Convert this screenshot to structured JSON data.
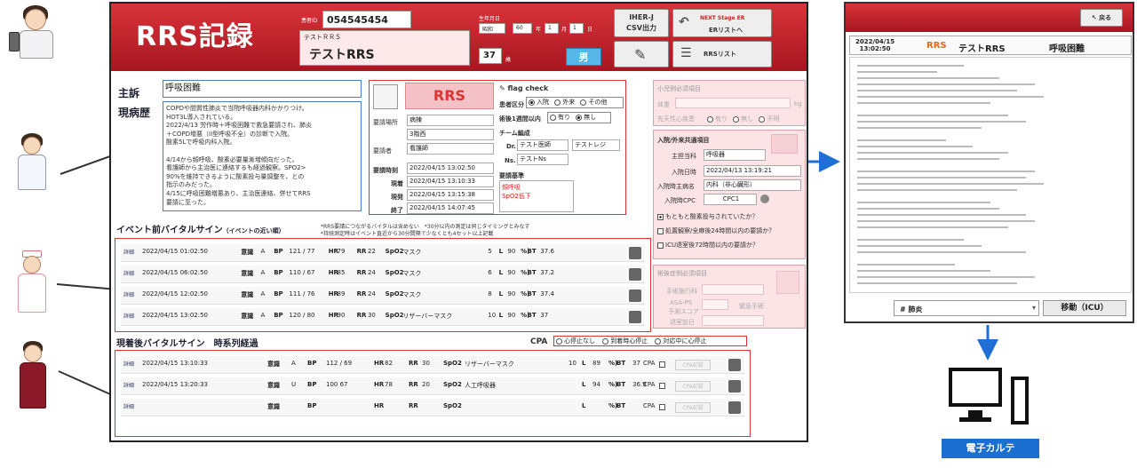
{
  "app": {
    "title": "RRS記録",
    "patient_id_label": "患者ID",
    "patient_id": "054545454",
    "kana_name": "テストＲＲＳ",
    "name": "テストRRS",
    "birth_label": "生年月日",
    "era": "昭和",
    "year": "60",
    "year_unit": "年",
    "month": "1",
    "month_unit": "月",
    "day": "1",
    "day_unit": "日",
    "age": "37",
    "age_unit": "歳",
    "sex": "男",
    "csv_button": "IHER-J\nCSV出力",
    "next_stage_logo": "NEXT Stage ER",
    "er_list_button": "ERリストへ",
    "rrs_list_button": "RRSリスト"
  },
  "complaint": {
    "label": "主訴",
    "value": "呼吸困難",
    "history_label": "現病歴",
    "history_lines": [
      "COPDや間質性肺炎で当院呼吸器内科かかりつけ。",
      "HOT3L導入されている。",
      "2022/4/13 労作時＋呼吸困難で救急要請され、肺炎",
      "＋COPD増悪（II型呼吸不全）の診断で入院。",
      "酸素5Lで呼吸内科入院。",
      "",
      "4/14から頻呼吸、酸素必要量漸増傾向だった。",
      "看護師から主治医に連絡するも経過観察。SPO2>",
      "90%を維持できるように酸素投与量調整を、との",
      "指示のみだった。",
      "4/15に呼吸困難増悪あり、主治医連絡、併せてRRS",
      "要請に至った。"
    ]
  },
  "rrs": {
    "badge": "RRS",
    "request_place_label": "要請場所",
    "request_place_1": "病棟",
    "request_place_2": "3階西",
    "requester_label": "要請者",
    "requester": "看護師",
    "request_time_label": "要請時刻",
    "request_time": "2022/04/15 13:02:50",
    "arrival_label": "現着",
    "arrival_time": "2022/04/15 13:10:33",
    "finding_label": "現発",
    "finding_time": "2022/04/15 13:15:38",
    "end_label": "終了",
    "end_time": "2022/04/15 14:07:45",
    "flag_check_label": "flag check",
    "patient_type_label": "患者区分",
    "patient_type_options": [
      "入院",
      "外来",
      "その他"
    ],
    "post_op_label": "術後1週間以内",
    "post_op_options": [
      "有り",
      "無し"
    ],
    "team_label": "チーム編成",
    "dr_label": "Dr.",
    "dr_1": "テスト医師",
    "dr_2": "テストレジ",
    "ns_label": "Ns.",
    "ns_1": "テストNs",
    "criteria_label": "要請基準",
    "criteria": [
      "頻呼吸",
      "SpO2低下"
    ]
  },
  "pediatric": {
    "title": "小児例必須項目",
    "weight_label": "体重",
    "weight_unit": "kg",
    "premature_label": "先天性心疾患",
    "premature_options": [
      "有り",
      "無し",
      "不明"
    ]
  },
  "inpatient": {
    "title": "入院/外来共通項目",
    "dept_label": "主担当科",
    "dept": "呼吸器",
    "admit_date_label": "入院日時",
    "admit_date": "2022/04/13 13:19:21",
    "admit_dx_label": "入院時主病名",
    "admit_dx": "内科（非心臓形）",
    "cpc_label": "入院時CPC",
    "cpc": "CPC1",
    "checks": [
      "もともと酸素投与されていたか？",
      "処置観察/全麻後24時間以内の要請か？",
      "ICU退室後72時間以内の要請か？"
    ]
  },
  "surgery": {
    "title": "術後症例必須項目",
    "op_dept_label": "手術施行科",
    "asa_label": "ASA-PS",
    "asa_sub": "予測スコア",
    "emergency_label": "緊急手術",
    "op_date_label": "退室前日"
  },
  "pre_vitals": {
    "title": "イベント前バイタルサイン",
    "subtitle": "（イベントの近い順）",
    "note_1": "*RRS要請につながるバイタルは含めない　*30分以内の測定は同じタイミングとみなす",
    "note_2": "*持続測定時はイベント直近から30分間隔で少なくとも4セット以上記載",
    "rows": [
      {
        "label": "詳細",
        "time": "2022/04/15 01:02:50",
        "conscious": "A",
        "bp": "121 / 77",
        "hr": "79",
        "rr": "22",
        "o2": "マスク",
        "flow": "5",
        "spo2": "90",
        "bt": "37.6"
      },
      {
        "label": "詳細",
        "time": "2022/04/15 06:02:50",
        "conscious": "A",
        "bp": "110 / 67",
        "hr": "85",
        "rr": "24",
        "o2": "マスク",
        "flow": "6",
        "spo2": "90",
        "bt": "37.2"
      },
      {
        "label": "詳細",
        "time": "2022/04/15 12:02:50",
        "conscious": "A",
        "bp": "111 / 76",
        "hr": "89",
        "rr": "24",
        "o2": "マスク",
        "flow": "8",
        "spo2": "90",
        "bt": "37.4"
      },
      {
        "label": "詳細",
        "time": "2022/04/15 13:02:50",
        "conscious": "A",
        "bp": "120 / 80",
        "hr": "90",
        "rr": "30",
        "o2": "リザーバーマスク",
        "flow": "10",
        "spo2": "90",
        "bt": "37"
      }
    ]
  },
  "post_vitals": {
    "title": "現着後バイタルサイン　時系列経過",
    "cpa_label": "CPA",
    "cpa_options": [
      "心停止なし",
      "到着時心停止",
      "対応中に心停止"
    ],
    "rows": [
      {
        "label": "詳細",
        "time": "2022/04/15 13:10:33",
        "conscious": "A",
        "bp": "112 / 69",
        "hr": "82",
        "rr": "30",
        "o2": "リザーバーマスク",
        "flow": "10",
        "spo2": "89",
        "bt": "37"
      },
      {
        "label": "詳細",
        "time": "2022/04/15 13:20:33",
        "conscious": "U",
        "bp": "100   67",
        "hr": "78",
        "rr": "20",
        "o2": "人工呼吸器",
        "flow": "",
        "spo2": "94",
        "bt": "36.9"
      },
      {
        "label": "詳細",
        "time": "",
        "conscious": "",
        "bp": "",
        "hr": "",
        "rr": "",
        "o2": "",
        "flow": "",
        "spo2": "",
        "bt": ""
      }
    ]
  },
  "vital_labels": {
    "conscious": "意識",
    "bp": "BP",
    "hr": "HR",
    "rr": "RR",
    "spo2": "SpO2",
    "flow_unit": "L",
    "pct": "%)",
    "bt": "BT",
    "cpa": "CPA",
    "cpa_btn": "CPA記録"
  },
  "emr": {
    "back_button": "戻る",
    "datetime": "2022/04/15\n13:02:50",
    "badge": "RRS",
    "name": "テストRRS",
    "complaint": "呼吸困難",
    "dx_value": "# 肺炎",
    "move_button": "移動（ICU）",
    "caption": "電子カルテ"
  }
}
